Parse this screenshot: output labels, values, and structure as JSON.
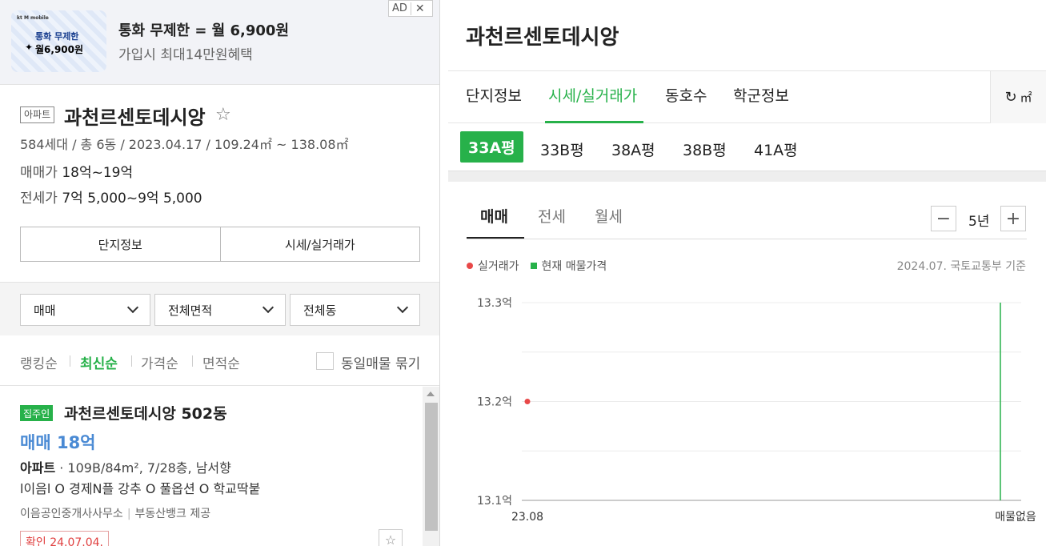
{
  "ad": {
    "badge": "AD",
    "close": "✕",
    "thumb_brand": "kt M mobile",
    "thumb_line1": "통화 무제한",
    "thumb_line2": "월6,900원",
    "title": "통화 무제한 = 월 6,900원",
    "subtitle": "가입시 최대14만원혜택"
  },
  "complex": {
    "type_tag": "아파트",
    "name": "과천르센토데시앙",
    "meta": "584세대 / 총 6동 / 2023.04.17 / 109.24㎡ ~ 138.08㎡",
    "sale_label": "매매가",
    "sale_value": "18억~19억",
    "lease_label": "전세가",
    "lease_value": "7억 5,000~9억 5,000",
    "btn_info": "단지정보",
    "btn_price": "시세/실거래가"
  },
  "filters": {
    "deal": "매매",
    "area": "전체면적",
    "dong": "전체동"
  },
  "sort": {
    "items": [
      "랭킹순",
      "최신순",
      "가격순",
      "면적순"
    ],
    "active": "최신순",
    "group_label": "동일매물 묶기"
  },
  "listing": {
    "owner_tag": "집주인",
    "name": "과천르센토데시앙 502동",
    "price": "매매 18억",
    "type": "아파트",
    "info": " · 109B/84m², 7/28층, 남서향",
    "desc": "l이음l O 경제N플 강추 O 풀옵션 O 학교딱붙",
    "agent": "이음공인중개사사무소",
    "provider": "부동산뱅크 제공",
    "confirm": "확인 24.07.04."
  },
  "right": {
    "title": "과천르센토데시앙",
    "tabs": [
      "단지정보",
      "시세/실거래가",
      "동호수",
      "학군정보"
    ],
    "active_tab": "시세/실거래가",
    "refresh_label": "㎡",
    "sizes": [
      "33A평",
      "33B평",
      "38A평",
      "38B평",
      "41A평"
    ],
    "active_size": "33A평",
    "chart_tabs": [
      "매매",
      "전세",
      "월세"
    ],
    "active_chart_tab": "매매",
    "zoom_minus": "−",
    "zoom_plus": "+",
    "period": "5년",
    "legend_actual": "실거래가",
    "legend_current": "현재 매물가격",
    "basis": "2024.07. 국토교통부 기준"
  },
  "colors": {
    "accent": "#27b14a",
    "actual_dot": "#e84848",
    "price_blue": "#4a8ad4"
  },
  "chart_data": {
    "type": "scatter",
    "y_ticks": [
      "13.3억",
      "13.2억",
      "13.1억"
    ],
    "ylim": [
      13.1,
      13.3
    ],
    "x_labels": [
      "23.08",
      "매물없음"
    ],
    "series": [
      {
        "name": "실거래가",
        "points": [
          {
            "x": "23.08",
            "y": 13.2
          }
        ]
      },
      {
        "name": "현재 매물가격",
        "points": [
          {
            "x": "매물없음",
            "y": null
          }
        ]
      }
    ]
  }
}
